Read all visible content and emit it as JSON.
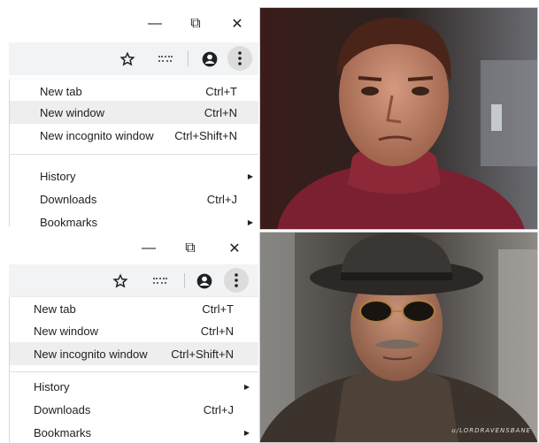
{
  "top_panel": {
    "titlebar": {
      "minimize": "—",
      "maximize": "⧉",
      "close": "✕"
    },
    "toolbar": {
      "bookmark_icon": "star-icon",
      "extension_icon": "extension-icon",
      "profile_icon": "account-icon",
      "menu_icon": "more-vert-icon"
    },
    "menu": [
      {
        "label": "New tab",
        "shortcut": "Ctrl+T"
      },
      {
        "label": "New window",
        "shortcut": "Ctrl+N",
        "highlighted": true
      },
      {
        "label": "New incognito window",
        "shortcut": "Ctrl+Shift+N"
      },
      {
        "label": "History",
        "submenu": true
      },
      {
        "label": "Downloads",
        "shortcut": "Ctrl+J"
      },
      {
        "label": "Bookmarks",
        "submenu": true
      }
    ]
  },
  "bottom_panel": {
    "titlebar": {
      "minimize": "—",
      "maximize": "⧉",
      "close": "✕"
    },
    "menu": [
      {
        "label": "New tab",
        "shortcut": "Ctrl+T"
      },
      {
        "label": "New window",
        "shortcut": "Ctrl+N"
      },
      {
        "label": "New incognito window",
        "shortcut": "Ctrl+Shift+N",
        "highlighted": true
      },
      {
        "label": "History",
        "submenu": true
      },
      {
        "label": "Downloads",
        "shortcut": "Ctrl+J"
      },
      {
        "label": "Bookmarks",
        "submenu": true
      }
    ]
  },
  "watermark": "u/LORDRAVENSBANE",
  "arrow_glyph": "▶"
}
